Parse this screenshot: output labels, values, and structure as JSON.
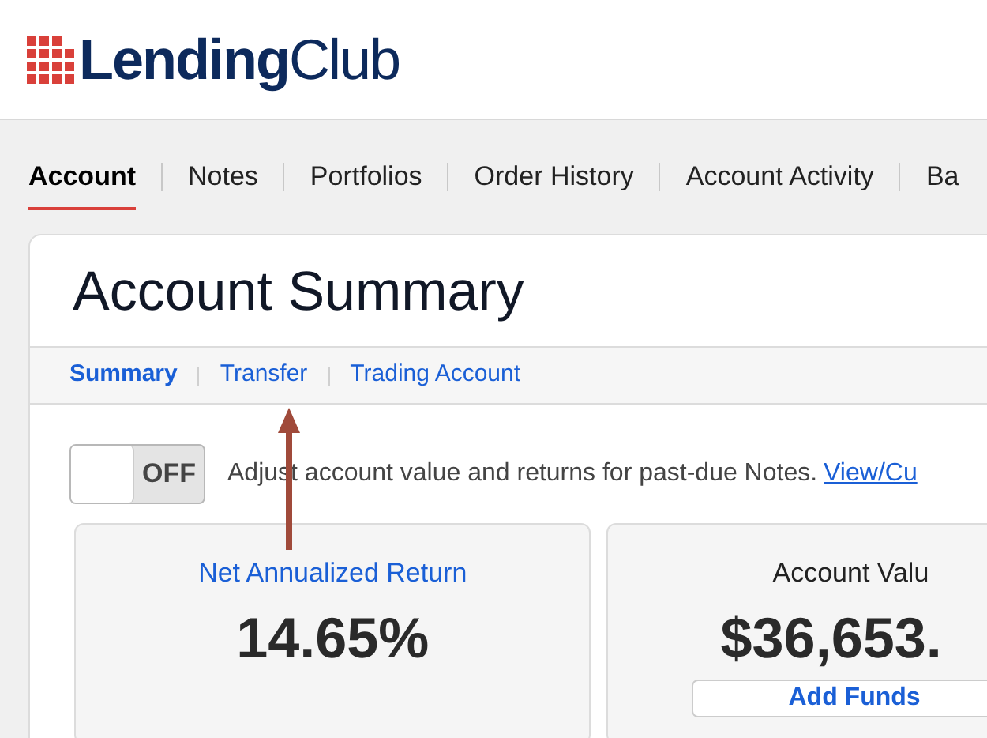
{
  "logo": {
    "text": "**Lending**Club"
  },
  "nav": [
    {
      "label": "Account",
      "selected": true
    },
    {
      "label": "Notes",
      "selected": false
    },
    {
      "label": "Portfolios",
      "selected": false
    },
    {
      "label": "Order History",
      "selected": false
    },
    {
      "label": "Account Activity",
      "selected": false
    },
    {
      "label": "Ba",
      "selected": false
    }
  ],
  "page_title": "Account Summary",
  "subtabs": [
    {
      "label": "Summary",
      "selected": true
    },
    {
      "label": "Transfer",
      "selected": false
    },
    {
      "label": "Trading Account",
      "selected": false
    }
  ],
  "past_due_toggle": {
    "on": false,
    "label": "OFF",
    "description": "Adjust account value and returns for past-due Notes.",
    "link": "View/Cu"
  },
  "cards": [
    {
      "title": "Net Annualized Return",
      "kind": "link",
      "value": "14.65%"
    },
    {
      "title": "Account Valu",
      "kind": "plain",
      "value": "$36,653.",
      "button": "Add Funds"
    }
  ]
}
